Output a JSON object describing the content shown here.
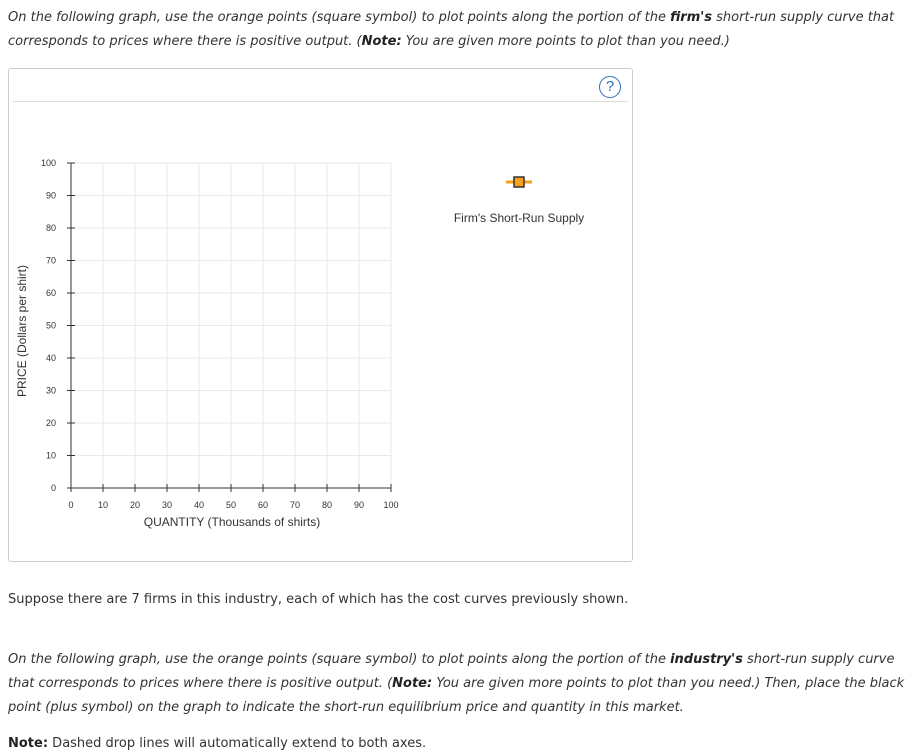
{
  "intro": {
    "part1": "On the following graph, use the orange points (square symbol) to plot points along the portion of the ",
    "bold1": "firm's",
    "part2": " short-run supply curve that corresponds to prices where there is positive output. (",
    "note_label": "Note:",
    "part3": " You are given more points to plot than you need.)"
  },
  "graph": {
    "help_icon": "question-circle-icon",
    "help_label": "?",
    "tool_icon": "orange-square-point-icon",
    "tool_label": "Firm's Short-Run Supply",
    "colors": {
      "tool_orange": "#f5a11b",
      "help_blue": "#2f6db5",
      "grid": "#e9e9e9"
    }
  },
  "chart_data": {
    "type": "scatter",
    "xlabel": "QUANTITY (Thousands of shirts)",
    "ylabel": "PRICE (Dollars per shirt)",
    "xlim": [
      0,
      100
    ],
    "ylim": [
      0,
      100
    ],
    "x_ticks": [
      "0",
      "10",
      "20",
      "30",
      "40",
      "50",
      "60",
      "70",
      "80",
      "90",
      "100"
    ],
    "y_ticks": [
      "0",
      "10",
      "20",
      "30",
      "40",
      "50",
      "60",
      "70",
      "80",
      "90",
      "100"
    ],
    "grid": true,
    "series": []
  },
  "para2": "Suppose there are 7 firms in this industry, each of which has the cost curves previously shown.",
  "para3": {
    "part1": "On the following graph, use the orange points (square symbol) to plot points along the portion of the ",
    "bold1": "industry's",
    "part2": " short-run supply curve that corresponds to prices where there is positive output. (",
    "note_label": "Note:",
    "part3": " You are given more points to plot than you need.) Then, place the black point (plus symbol) on the graph to indicate the short-run equilibrium price and quantity in this market."
  },
  "para4": {
    "note_label": "Note:",
    "text": " Dashed drop lines will automatically extend to both axes."
  }
}
